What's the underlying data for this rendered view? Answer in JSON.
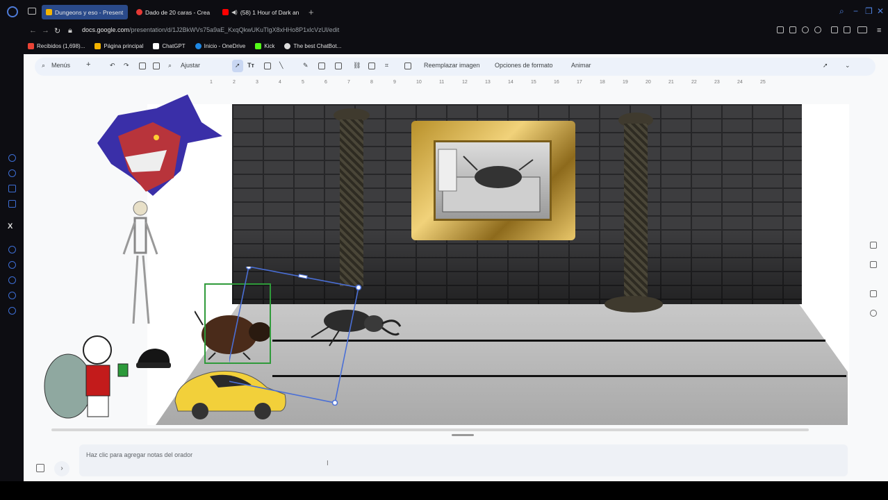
{
  "browser": {
    "tabs": [
      {
        "label": "Dungeons y eso - Present",
        "active": true,
        "color": "#f4b400"
      },
      {
        "label": "Dado de 20 caras - Crea",
        "active": false,
        "color": "#e53935"
      },
      {
        "label": "(58) 1 Hour of Dark an",
        "active": false,
        "color": "#ff0000"
      }
    ],
    "url_domain": "docs.google.com",
    "url_path": "/presentation/d/1J2BkWVs75a9aE_KxqQkwUKuTlgX8xHHo8P1xlcVzUl/edit",
    "bookmarks": [
      {
        "label": "Recibidos (1,698)...",
        "color": "#ea4335"
      },
      {
        "label": "Página principal",
        "color": "#f4b400"
      },
      {
        "label": "ChatGPT",
        "color": "#ffffff"
      },
      {
        "label": "Inicio - OneDrive",
        "color": "#1e88e5"
      },
      {
        "label": "Kick",
        "color": "#53fc18"
      },
      {
        "label": "The best ChatBot...",
        "color": "#dddddd"
      }
    ],
    "accent_color": "#4e7bd8"
  },
  "toolbar": {
    "menus": "Menús",
    "fit": "Ajustar",
    "replace_image": "Reemplazar imagen",
    "format_options": "Opciones de formato",
    "animate": "Animar"
  },
  "ruler": {
    "ticks": [
      "1",
      "2",
      "3",
      "4",
      "5",
      "6",
      "7",
      "8",
      "9",
      "10",
      "11",
      "12",
      "13",
      "14",
      "15",
      "16",
      "17",
      "18",
      "19",
      "20",
      "21",
      "22",
      "23",
      "24",
      "25"
    ]
  },
  "notes": {
    "placeholder": "Haz clic para agregar notas del orador"
  },
  "colors": {
    "wall": "#3d3d3f",
    "floor": "#bdbdbd",
    "selection": "#4a6fd6",
    "crop_box": "#2f9a3a",
    "frame_gold": "#d4ad4a",
    "car_yellow": "#f2d03a"
  }
}
